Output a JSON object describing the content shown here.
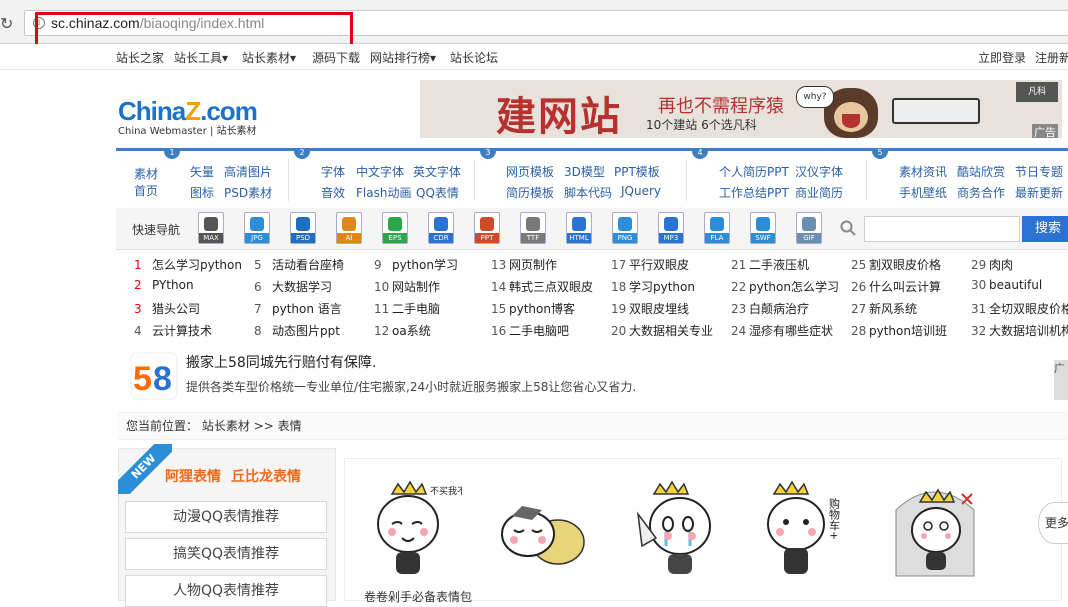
{
  "browser": {
    "url_host": "sc.chinaz.com",
    "url_path": "/biaoqing/index.html"
  },
  "topnav": {
    "items": [
      "站长之家",
      "站长工具▾",
      "站长素材▾",
      "源码下载",
      "网站排行榜▾",
      "站长论坛"
    ],
    "login": "立即登录",
    "register": "注册新"
  },
  "logo": {
    "china": "China",
    "z": "Z",
    "com": ".com",
    "subtitle": "China Webmaster | 站长素材"
  },
  "banner": {
    "headline": "建网站",
    "tagline": "再也不需程序猿",
    "subline": "10个建站 6个选凡科",
    "why": "why?",
    "brand": "凡科",
    "ad_label": "广告"
  },
  "catnav": {
    "home": [
      "素材",
      "首页"
    ],
    "numbers": [
      "1",
      "2",
      "3",
      "4",
      "5"
    ],
    "group1": [
      [
        "矢量",
        "高清图片"
      ],
      [
        "图标",
        "PSD素材"
      ]
    ],
    "group2": [
      [
        "字体",
        "中文字体",
        "英文字体"
      ],
      [
        "音效",
        "Flash动画",
        "QQ表情"
      ]
    ],
    "group3": [
      [
        "网页模板",
        "3D模型",
        "PPT模板"
      ],
      [
        "简历模板",
        "脚本代码",
        "JQuery"
      ]
    ],
    "group4": [
      [
        "个人简历PPT",
        "汉仪字体"
      ],
      [
        "工作总结PPT",
        "商业简历"
      ]
    ],
    "group5": [
      [
        "素材资讯",
        "酷站欣赏",
        "节日专题"
      ],
      [
        "手机壁纸",
        "商务合作",
        "最新更新"
      ]
    ]
  },
  "quicknav": {
    "label": "快速导航",
    "icons": [
      "MAX",
      "JPG",
      "PSD",
      "AI",
      "EPS",
      "CDR",
      "PPT",
      "TTF",
      "HTML",
      "PNG",
      "MP3",
      "FLA",
      "SWF",
      "GIF"
    ],
    "search_button": "搜索"
  },
  "hotlist": [
    [
      {
        "n": "1",
        "t": "怎么学习python"
      },
      {
        "n": "2",
        "t": "PYthon"
      },
      {
        "n": "3",
        "t": "猎头公司"
      },
      {
        "n": "4",
        "t": "云计算技术"
      }
    ],
    [
      {
        "n": "5",
        "t": "活动看台座椅"
      },
      {
        "n": "6",
        "t": "大数据学习"
      },
      {
        "n": "7",
        "t": "python 语言"
      },
      {
        "n": "8",
        "t": "动态图片ppt"
      }
    ],
    [
      {
        "n": "9",
        "t": "python学习"
      },
      {
        "n": "10",
        "t": "网站制作"
      },
      {
        "n": "11",
        "t": "二手电脑"
      },
      {
        "n": "12",
        "t": "oa系统"
      }
    ],
    [
      {
        "n": "13",
        "t": "网页制作"
      },
      {
        "n": "14",
        "t": "韩式三点双眼皮"
      },
      {
        "n": "15",
        "t": "python博客"
      },
      {
        "n": "16",
        "t": "二手电脑吧"
      }
    ],
    [
      {
        "n": "17",
        "t": "平行双眼皮"
      },
      {
        "n": "18",
        "t": "学习python"
      },
      {
        "n": "19",
        "t": "双眼皮埋线"
      },
      {
        "n": "20",
        "t": "大数据相关专业"
      }
    ],
    [
      {
        "n": "21",
        "t": "二手液压机"
      },
      {
        "n": "22",
        "t": "python怎么学习"
      },
      {
        "n": "23",
        "t": "白颠病治疗"
      },
      {
        "n": "24",
        "t": "湿疹有哪些症状"
      }
    ],
    [
      {
        "n": "25",
        "t": "割双眼皮价格"
      },
      {
        "n": "26",
        "t": "什么叫云计算"
      },
      {
        "n": "27",
        "t": "新风系统"
      },
      {
        "n": "28",
        "t": "python培训班"
      }
    ],
    [
      {
        "n": "29",
        "t": "肉肉"
      },
      {
        "n": "30",
        "t": "beautiful"
      },
      {
        "n": "31",
        "t": "全切双眼皮价格"
      },
      {
        "n": "32",
        "t": "大数据培训机构"
      }
    ]
  ],
  "ad58": {
    "logo": "58",
    "title": "搬家上58同城先行赔付有保障.",
    "desc": "提供各类车型价格统一专业单位/住宅搬家,24小时就近服务搬家上58让您省心又省力.",
    "side": "广"
  },
  "breadcrumb": {
    "label": "您当前位置：",
    "crumb1": "站长素材",
    "sep": ">>",
    "crumb2": "表情"
  },
  "leftpanel": {
    "new_badge": "NEW",
    "link1": "阿狸表情",
    "link2": "丘比龙表情",
    "buttons": [
      "动漫QQ表情推荐",
      "搞笑QQ表情推荐",
      "人物QQ表情推荐"
    ]
  },
  "main": {
    "bubble_text": "不买我不买!",
    "emoji4_text": "购物车+",
    "more": "更多",
    "caption": "卷卷剁手必备表情包"
  },
  "colors": {
    "accent": "#3d7fc1",
    "search_btn": "#2a72d3",
    "red_highlight": "#e2000f",
    "orange_link": "#f06a1a"
  }
}
